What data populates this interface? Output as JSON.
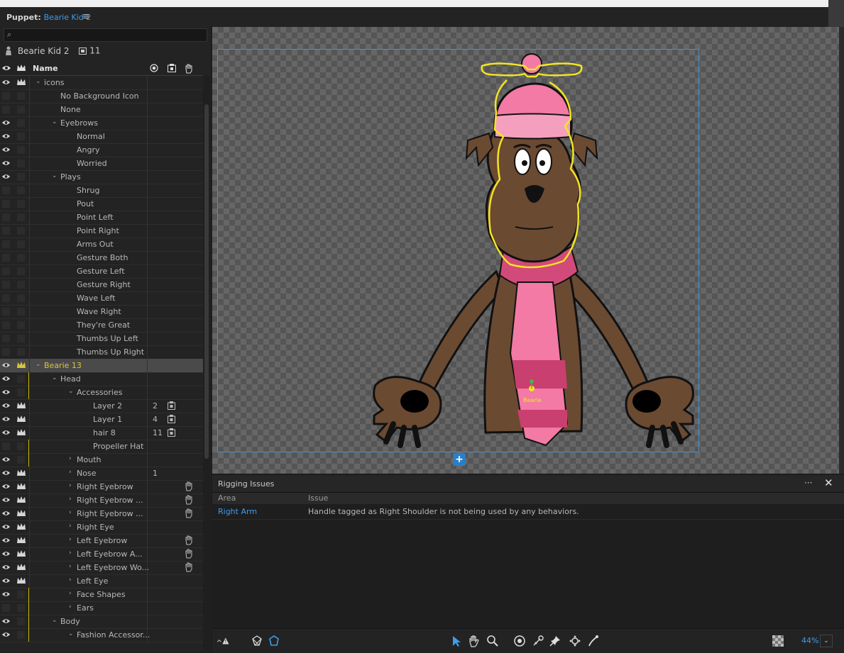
{
  "titlebar": {
    "prefix": "Puppet:",
    "name": "Bearie Kid 2",
    "menu": "≡"
  },
  "puppet_info": {
    "name": "Bearie Kid 2",
    "count": "11"
  },
  "column_header": {
    "name": "Name"
  },
  "tree": [
    {
      "label": "icons",
      "depth": 0,
      "twisty": "open",
      "eye": true,
      "crown": true
    },
    {
      "label": "No Background Icon",
      "depth": 1,
      "twisty": "none",
      "eye": false,
      "crown": false
    },
    {
      "label": "None",
      "depth": 1,
      "twisty": "none",
      "eye": false,
      "crown": false
    },
    {
      "label": "Eyebrows",
      "depth": 1,
      "twisty": "open",
      "eye": true,
      "crown": false
    },
    {
      "label": "Normal",
      "depth": 2,
      "twisty": "none",
      "eye": true,
      "crown": false
    },
    {
      "label": "Angry",
      "depth": 2,
      "twisty": "none",
      "eye": true,
      "crown": false
    },
    {
      "label": "Worried",
      "depth": 2,
      "twisty": "none",
      "eye": true,
      "crown": false
    },
    {
      "label": "Plays",
      "depth": 1,
      "twisty": "open",
      "eye": true,
      "crown": false
    },
    {
      "label": "Shrug",
      "depth": 2,
      "twisty": "none",
      "eye": false,
      "crown": false
    },
    {
      "label": "Pout",
      "depth": 2,
      "twisty": "none",
      "eye": false,
      "crown": false
    },
    {
      "label": "Point Left",
      "depth": 2,
      "twisty": "none",
      "eye": false,
      "crown": false
    },
    {
      "label": "Point Right",
      "depth": 2,
      "twisty": "none",
      "eye": false,
      "crown": false
    },
    {
      "label": "Arms Out",
      "depth": 2,
      "twisty": "none",
      "eye": false,
      "crown": false
    },
    {
      "label": "Gesture Both",
      "depth": 2,
      "twisty": "none",
      "eye": false,
      "crown": false
    },
    {
      "label": "Gesture Left",
      "depth": 2,
      "twisty": "none",
      "eye": false,
      "crown": false
    },
    {
      "label": "Gesture Right",
      "depth": 2,
      "twisty": "none",
      "eye": false,
      "crown": false
    },
    {
      "label": "Wave Left",
      "depth": 2,
      "twisty": "none",
      "eye": false,
      "crown": false
    },
    {
      "label": "Wave Right",
      "depth": 2,
      "twisty": "none",
      "eye": false,
      "crown": false
    },
    {
      "label": "They're Great",
      "depth": 2,
      "twisty": "none",
      "eye": false,
      "crown": false
    },
    {
      "label": "Thumbs Up Left",
      "depth": 2,
      "twisty": "none",
      "eye": false,
      "crown": false
    },
    {
      "label": "Thumbs Up Right",
      "depth": 2,
      "twisty": "none",
      "eye": false,
      "crown": false
    },
    {
      "label": "Bearie 13",
      "depth": 0,
      "twisty": "open",
      "eye": true,
      "crown": true,
      "selected": true
    },
    {
      "label": "Head",
      "depth": 1,
      "twisty": "open",
      "eye": true,
      "crown": false,
      "ybar": true
    },
    {
      "label": "Accessories",
      "depth": 2,
      "twisty": "open",
      "eye": true,
      "crown": false,
      "ybar": true
    },
    {
      "label": "Layer 2",
      "depth": 3,
      "twisty": "none",
      "eye": true,
      "crown": true,
      "num": "2",
      "rig": true
    },
    {
      "label": "Layer 1",
      "depth": 3,
      "twisty": "none",
      "eye": true,
      "crown": true,
      "num": "4",
      "rig": true
    },
    {
      "label": "hair 8",
      "depth": 3,
      "twisty": "none",
      "eye": true,
      "crown": true,
      "num": "11",
      "rig": true
    },
    {
      "label": "Propeller Hat",
      "depth": 3,
      "twisty": "none",
      "eye": false,
      "crown": false,
      "ybar": true
    },
    {
      "label": "Mouth",
      "depth": 2,
      "twisty": "closed",
      "eye": true,
      "crown": false,
      "ybar": true
    },
    {
      "label": "Nose",
      "depth": 2,
      "twisty": "closed",
      "eye": true,
      "crown": true,
      "num": "1"
    },
    {
      "label": "Right Eyebrow",
      "depth": 2,
      "twisty": "closed",
      "eye": true,
      "crown": true,
      "hand": true
    },
    {
      "label": "Right Eyebrow ...",
      "depth": 2,
      "twisty": "closed",
      "eye": true,
      "crown": true,
      "hand": true
    },
    {
      "label": "Right Eyebrow ...",
      "depth": 2,
      "twisty": "closed",
      "eye": true,
      "crown": true,
      "hand": true
    },
    {
      "label": "Right Eye",
      "depth": 2,
      "twisty": "closed",
      "eye": true,
      "crown": true
    },
    {
      "label": "Left Eyebrow",
      "depth": 2,
      "twisty": "closed",
      "eye": true,
      "crown": true,
      "hand": true
    },
    {
      "label": "Left Eyebrow A...",
      "depth": 2,
      "twisty": "closed",
      "eye": true,
      "crown": true,
      "hand": true
    },
    {
      "label": "Left Eyebrow Wo...",
      "depth": 2,
      "twisty": "closed",
      "eye": true,
      "crown": true,
      "hand": true
    },
    {
      "label": "Left Eye",
      "depth": 2,
      "twisty": "closed",
      "eye": true,
      "crown": true
    },
    {
      "label": "Face Shapes",
      "depth": 2,
      "twisty": "closed",
      "eye": true,
      "crown": false,
      "ybar": true
    },
    {
      "label": "Ears",
      "depth": 2,
      "twisty": "closed",
      "eye": false,
      "crown": false,
      "ybar": true
    },
    {
      "label": "Body",
      "depth": 1,
      "twisty": "open",
      "eye": true,
      "crown": false,
      "ybar": true
    },
    {
      "label": "Fashion Accessor...",
      "depth": 2,
      "twisty": "open",
      "eye": true,
      "crown": false,
      "ybar": true
    }
  ],
  "canvas": {
    "handle_label": "Bearie",
    "add_label": "+"
  },
  "rigging": {
    "title": "Rigging Issues",
    "menu": "···",
    "close": "✕",
    "col_area": "Area",
    "col_issue": "Issue",
    "rows": [
      {
        "area": "Right Arm",
        "issue": "Handle tagged as Right Shoulder is not being used by any behaviors."
      }
    ]
  },
  "toolbar": {
    "zoom": "44%"
  },
  "colors": {
    "accent": "#3d9df0",
    "selection_text": "#d7c63a",
    "outline": "#f2e521"
  },
  "icons": [
    "search-icon",
    "puppet-icon",
    "eye-icon",
    "crown-icon",
    "rig-icon",
    "hand-icon",
    "select-tool-icon",
    "hand-tool-icon",
    "zoom-tool-icon",
    "origin-icon",
    "dragger-icon",
    "pin-icon",
    "transform-icon",
    "stick-icon"
  ]
}
